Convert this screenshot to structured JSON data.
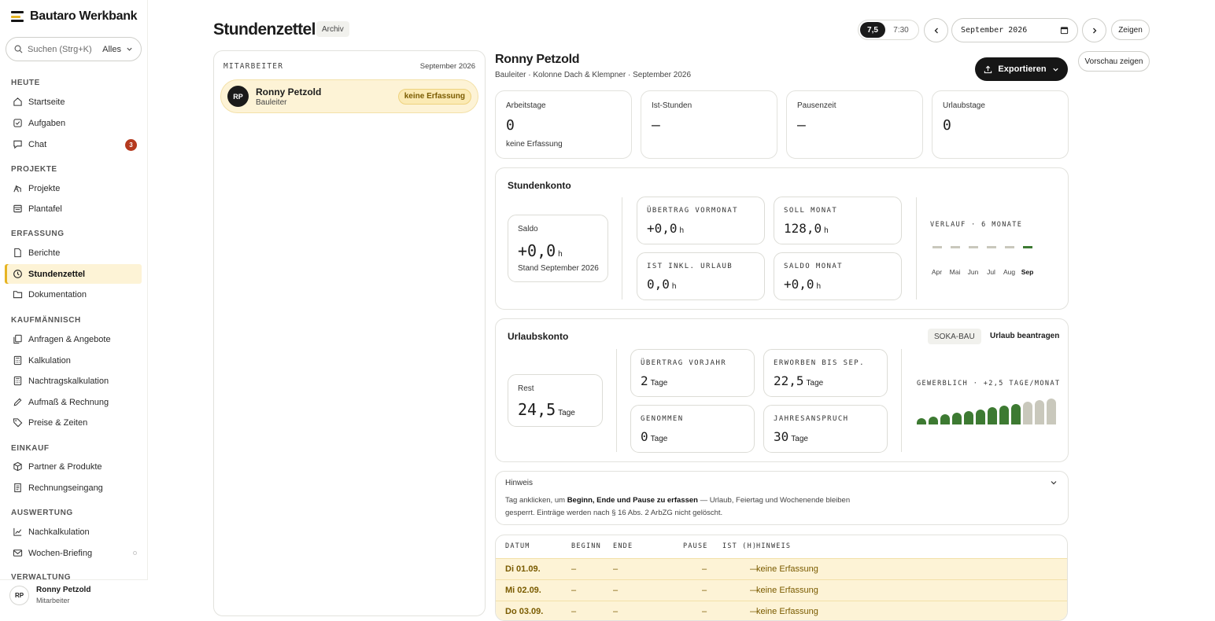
{
  "sidebar": {
    "brand": "Bautaro Werkbank",
    "search_placeholder": "Suchen (Strg+K)",
    "search_scope": "Alles",
    "groups": {
      "heute": "HEUTE",
      "projekte": "PROJEKTE",
      "erfassung": "ERFASSUNG",
      "kaufm": "KAUFMÄNNISCH",
      "einkauf": "EINKAUF",
      "auswertung": "AUSWERTUNG",
      "verwaltung": "VERWALTUNG"
    },
    "items": {
      "startseite": "Startseite",
      "aufgaben": "Aufgaben",
      "chat": "Chat",
      "chat_badge": "3",
      "projekte": "Projekte",
      "plantafel": "Plantafel",
      "berichte": "Berichte",
      "stundenzettel": "Stundenzettel",
      "dokumentation": "Dokumentation",
      "anfragen": "Anfragen & Angebote",
      "kalkulation": "Kalkulation",
      "nachtrag": "Nachtragskalkulation",
      "aufmass": "Aufmaß & Rechnung",
      "preise": "Preise & Zeiten",
      "partner": "Partner & Produkte",
      "rechnungseingang": "Rechnungseingang",
      "nachkalkulation": "Nachkalkulation",
      "briefing": "Wochen-Briefing"
    },
    "user": {
      "initials": "RP",
      "name": "Ronny Petzold",
      "role": "Mitarbeiter"
    }
  },
  "header": {
    "title": "Stundenzettel",
    "archive": "Archiv",
    "toggle_on": "7,5",
    "toggle_off": "7:30",
    "month_value": "September 2026",
    "show": "Zeigen",
    "preview": "Vorschau zeigen"
  },
  "employees": {
    "head_label": "MITARBEITER",
    "head_month": "September 2026",
    "row": {
      "initials": "RP",
      "name": "Ronny Petzold",
      "role": "Bauleiter",
      "status": "keine Erfassung"
    }
  },
  "detail": {
    "name": "Ronny Petzold",
    "subtitle": "Bauleiter · Kolonne Dach & Klempner · September 2026",
    "export": "Exportieren",
    "stats": [
      {
        "label": "Arbeitstage",
        "value": "0",
        "note": "keine Erfassung"
      },
      {
        "label": "Ist-Stunden",
        "value": "—"
      },
      {
        "label": "Pausenzeit",
        "value": "—"
      },
      {
        "label": "Urlaubstage",
        "value": "0"
      }
    ],
    "konto": {
      "title": "Stundenkonto",
      "saldo_label": "Saldo",
      "saldo_value": "+0,0",
      "saldo_unit": "h",
      "saldo_note": "Stand September 2026",
      "cells": [
        {
          "label": "ÜBERTRAG VORMONAT",
          "value": "+0,0",
          "unit": "h"
        },
        {
          "label": "SOLL MONAT",
          "value": "128,0",
          "unit": "h"
        },
        {
          "label": "IST INKL. URLAUB",
          "value": "0,0",
          "unit": "h"
        },
        {
          "label": "SALDO MONAT",
          "value": "+0,0",
          "unit": "h"
        }
      ],
      "trend_label": "VERLAUF · 6 MONATE",
      "months": [
        "Apr",
        "Mai",
        "Jun",
        "Jul",
        "Aug",
        "Sep"
      ]
    },
    "urlaub": {
      "title": "Urlaubskonto",
      "soka": "SOKA-BAU",
      "request": "Urlaub beantragen",
      "rest_label": "Rest",
      "rest_value": "24,5",
      "rest_unit": "Tage",
      "cells": [
        {
          "label": "ÜBERTRAG VORJAHR",
          "value": "2",
          "unit": "Tage"
        },
        {
          "label": "ERWORBEN BIS SEP.",
          "value": "22,5",
          "unit": "Tage"
        },
        {
          "label": "GENOMMEN",
          "value": "0",
          "unit": "Tage"
        },
        {
          "label": "JAHRESANSPRUCH",
          "value": "30",
          "unit": "Tage"
        }
      ],
      "accrual_label": "GEWERBLICH · +2,5 TAGE/MONAT",
      "accrual_months_earned": 9,
      "accrual_months_total": 12
    },
    "hint": {
      "title": "Hinweis",
      "text_pre": "Tag anklicken, um ",
      "text_bold": "Beginn, Ende und Pause zu erfassen",
      "text_post": " — Urlaub, Feiertag und Wochenende bleiben gesperrt. Einträge werden nach § 16 Abs. 2 ArbZG nicht gelöscht."
    },
    "table": {
      "headers": {
        "datum": "DATUM",
        "beginn": "BEGINN",
        "ende": "ENDE",
        "pause": "PAUSE",
        "ist": "IST (H)",
        "hinweis": "HINWEIS"
      },
      "rows": [
        {
          "datum": "Di 01.09.",
          "beginn": "–",
          "ende": "–",
          "pause": "–",
          "ist": "—",
          "hinweis": "keine Erfassung"
        },
        {
          "datum": "Mi 02.09.",
          "beginn": "–",
          "ende": "–",
          "pause": "–",
          "ist": "—",
          "hinweis": "keine Erfassung"
        },
        {
          "datum": "Do 03.09.",
          "beginn": "–",
          "ende": "–",
          "pause": "–",
          "ist": "—",
          "hinweis": "keine Erfassung"
        }
      ]
    }
  },
  "colors": {
    "accent": "#e6b422",
    "highlight": "#fdf3d6",
    "green": "#3d7a32",
    "gray_bar": "#c9c8bc",
    "dark": "#161616",
    "badge": "#b53a1f"
  }
}
